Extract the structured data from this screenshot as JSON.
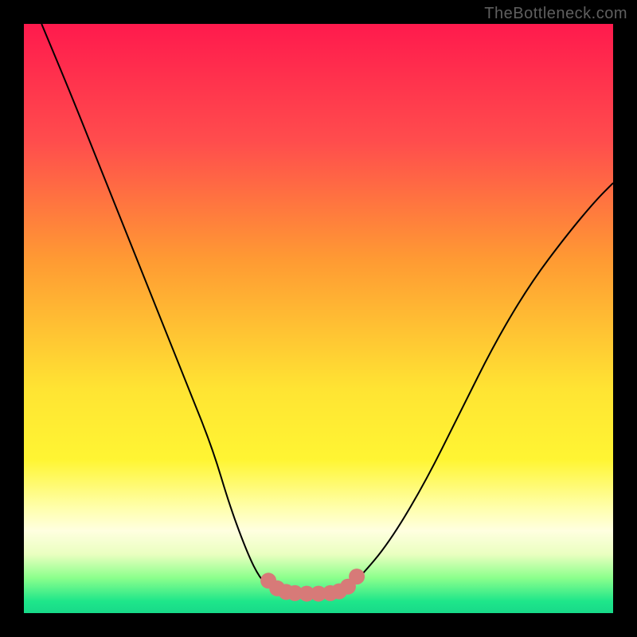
{
  "watermark": "TheBottleneck.com",
  "colors": {
    "page_bg": "#000000",
    "gradient_top": "#ff1a4d",
    "gradient_mid": "#ffe433",
    "gradient_bottom": "#18d989",
    "curve": "#000000",
    "markers": "#d77a78"
  },
  "chart_data": {
    "type": "line",
    "title": "",
    "xlabel": "",
    "ylabel": "",
    "xlim": [
      0,
      100
    ],
    "ylim": [
      0,
      100
    ],
    "series": [
      {
        "name": "left-branch",
        "x": [
          3,
          8,
          12,
          16,
          20,
          24,
          28,
          32,
          35,
          38,
          40,
          42,
          43.5
        ],
        "y": [
          100,
          88,
          78,
          68,
          58,
          48,
          38,
          28,
          18,
          10,
          6,
          4,
          3.5
        ]
      },
      {
        "name": "valley-floor",
        "x": [
          43.5,
          46,
          49,
          52,
          54
        ],
        "y": [
          3.5,
          3.3,
          3.3,
          3.4,
          3.6
        ]
      },
      {
        "name": "right-branch",
        "x": [
          54,
          57,
          62,
          68,
          74,
          80,
          86,
          92,
          97,
          100
        ],
        "y": [
          3.6,
          6,
          12,
          22,
          34,
          46,
          56,
          64,
          70,
          73
        ]
      }
    ],
    "markers": {
      "name": "bottom-dots",
      "x": [
        41.5,
        43,
        44.5,
        46,
        48,
        50,
        52,
        53.5,
        55,
        56.5
      ],
      "y": [
        5.5,
        4.2,
        3.6,
        3.4,
        3.3,
        3.3,
        3.4,
        3.7,
        4.5,
        6.2
      ],
      "radius_pct": 1.35
    },
    "grid": false,
    "legend": false
  }
}
